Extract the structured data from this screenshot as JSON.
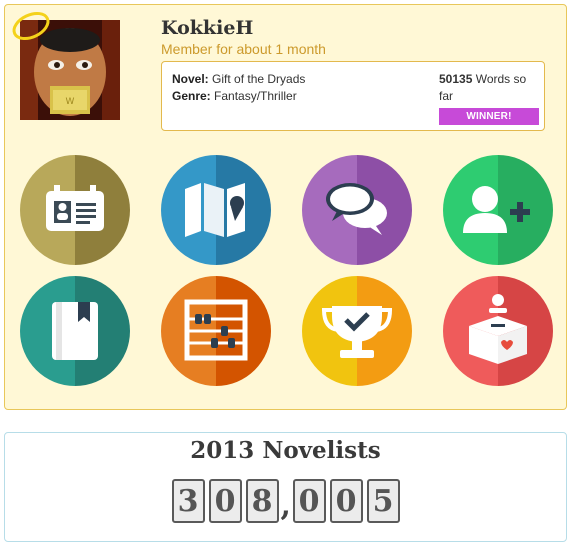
{
  "profile": {
    "username": "KokkieH",
    "member_since": "Member for about 1 month"
  },
  "novel": {
    "novel_label": "Novel:",
    "novel_title": "Gift of the Dryads",
    "genre_label": "Genre:",
    "genre_value": "Fantasy/Thriller",
    "word_count": "50135",
    "word_count_suffix": "Words so far",
    "badge": "WINNER!"
  },
  "stats": {
    "title": "2013 Novelists",
    "digits": [
      "3",
      "0",
      "8",
      ",",
      "0",
      "0",
      "5"
    ]
  },
  "icons": [
    {
      "name": "id-badge-icon",
      "color": "#b8a85a"
    },
    {
      "name": "map-icon",
      "color": "#3498c8"
    },
    {
      "name": "chat-bubbles-icon",
      "color": "#9b59b6"
    },
    {
      "name": "add-user-icon",
      "color": "#2ecc71"
    },
    {
      "name": "book-icon",
      "color": "#2a9d8f"
    },
    {
      "name": "abacus-icon",
      "color": "#e67e22"
    },
    {
      "name": "trophy-icon",
      "color": "#f1c40f"
    },
    {
      "name": "donation-box-icon",
      "color": "#e74c3c"
    }
  ]
}
